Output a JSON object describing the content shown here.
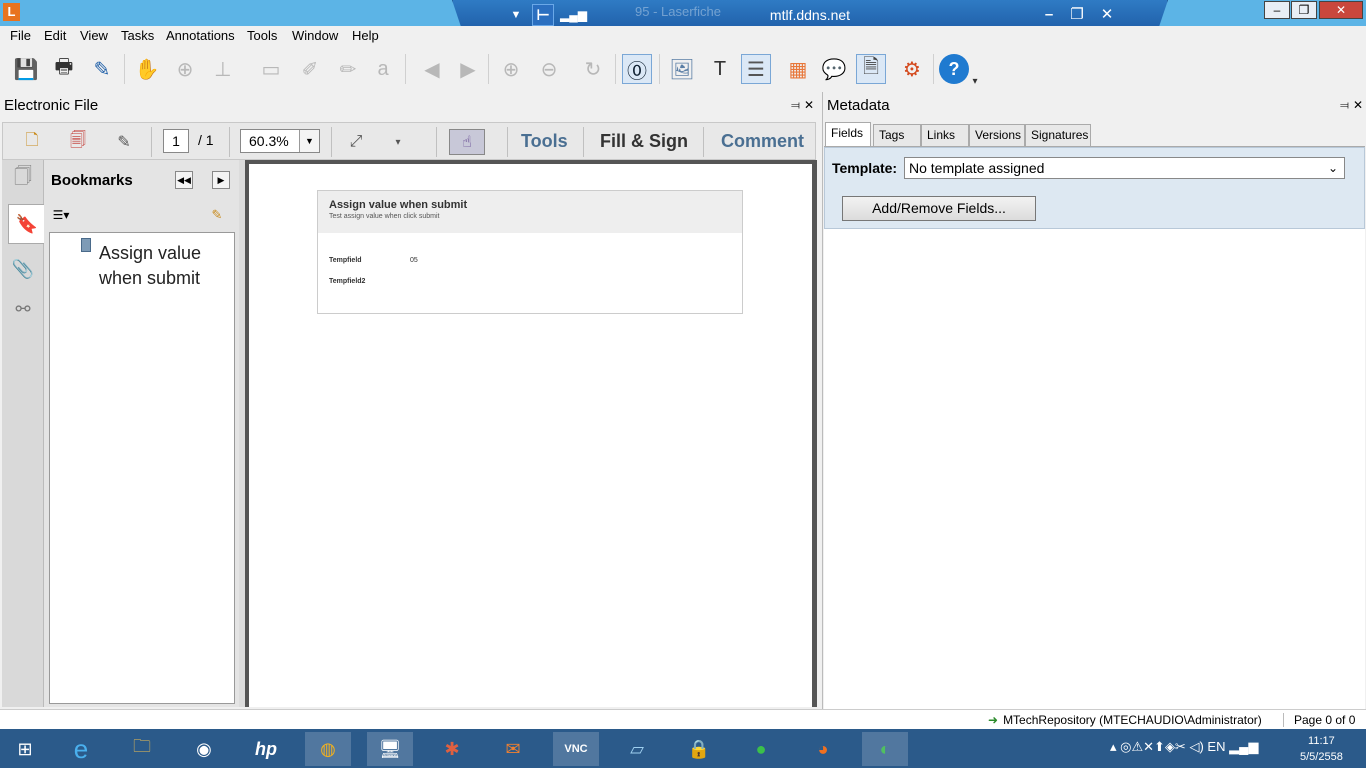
{
  "titlebar": {
    "app_logo": "L",
    "vnc_ghost": "95 - Laserfiche",
    "vnc_host": "mtlf.ddns.net",
    "minimize": "–",
    "restore": "❐",
    "close": "✕"
  },
  "menu": [
    "File",
    "Edit",
    "View",
    "Tasks",
    "Annotations",
    "Tools",
    "Window",
    "Help"
  ],
  "left_panel": {
    "title": "Electronic File",
    "pin": "📌",
    "close": "✕",
    "page_current": "1",
    "page_total": "/ 1",
    "zoom": "60.3%",
    "links": [
      "Tools",
      "Fill & Sign",
      "Comment"
    ],
    "bookmarks": {
      "title": "Bookmarks",
      "item": "Assign value when submit"
    },
    "form": {
      "title": "Assign value when submit",
      "subtitle": "Test assign value when click submit",
      "fields": [
        {
          "label": "Tempfield",
          "value": "05"
        },
        {
          "label": "Tempfield2",
          "value": ""
        }
      ]
    }
  },
  "metadata": {
    "title": "Metadata",
    "pin": "📌",
    "close": "✕",
    "tabs": [
      "Fields",
      "Tags",
      "Links",
      "Versions",
      "Signatures"
    ],
    "template_label": "Template:",
    "template_value": "No template assigned",
    "add_remove_button": "Add/Remove Fields..."
  },
  "statusbar": {
    "repository": "MTechRepository (MTECHAUDIO\\Administrator)",
    "page": "Page 0 of 0"
  },
  "taskbar": {
    "time": "11:17",
    "date": "5/5/2558",
    "lang": "EN"
  },
  "colors": {
    "titlebar": "#5cb4e6",
    "taskbar": "#2b5a8a",
    "acro_link": "#4a6f92",
    "form_bg": "#dde8f2"
  }
}
